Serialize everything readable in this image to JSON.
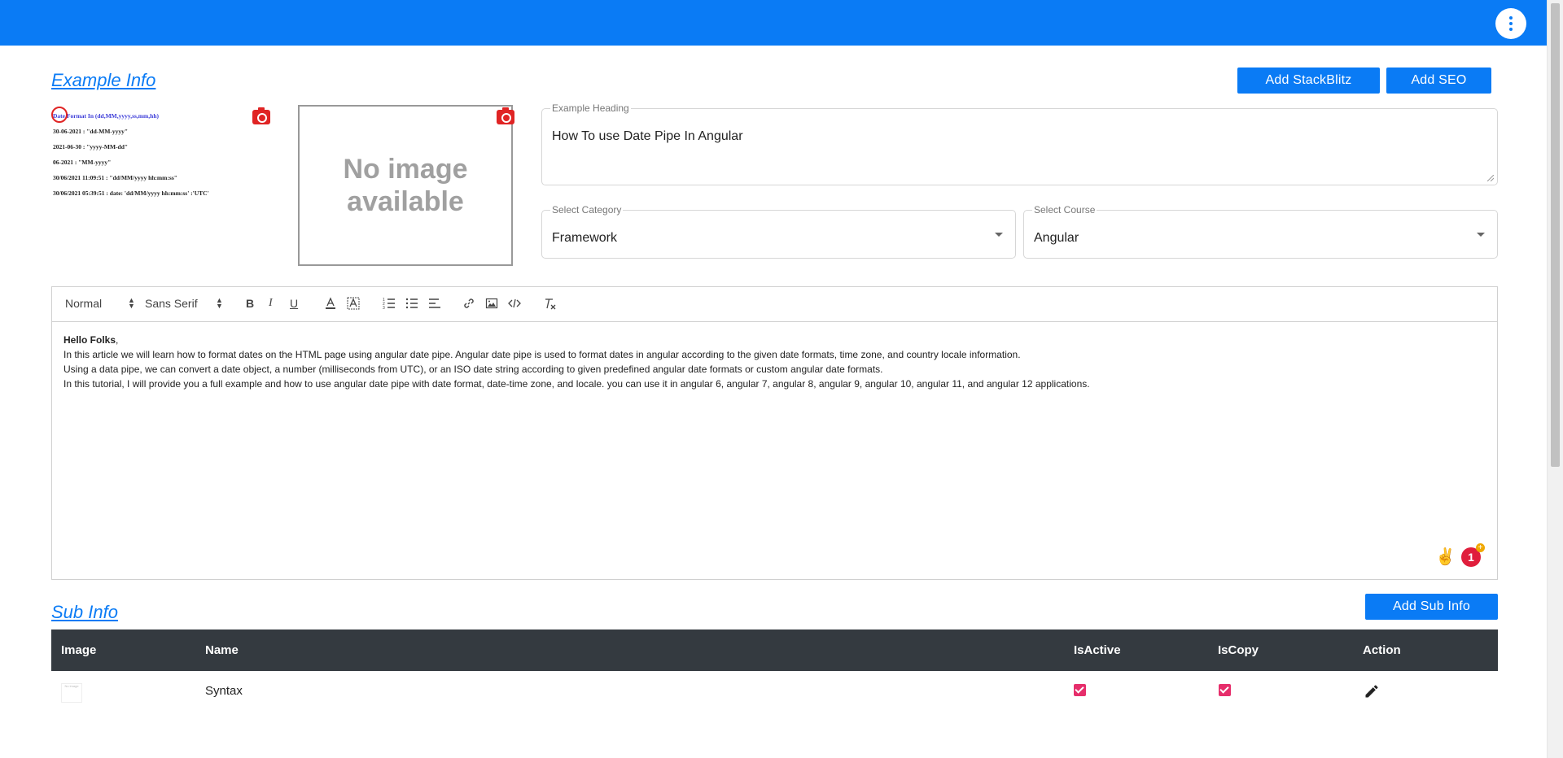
{
  "header": {
    "menu_icon": "more-vert-icon",
    "color": "#0a7bf5"
  },
  "example_info": {
    "title": "Example Info",
    "buttons": {
      "add_stackblitz": "Add StackBlitz",
      "add_seo": "Add SEO"
    },
    "thumbnail_lines": [
      "Date Format In (dd,MM,yyyy,ss,mm,hh)",
      "30-06-2021 : \"dd-MM-yyyy\"",
      "2021-06-30 : \"yyyy-MM-dd\"",
      "06-2021 : \"MM-yyyy\"",
      "30/06/2021 11:09:51 : \"dd/MM/yyyy hh:mm:ss\"",
      "30/06/2021 05:39:51 : date: 'dd/MM/yyyy hh:mm:ss' :'UTC'"
    ],
    "no_image_text": "No image available",
    "heading": {
      "label": "Example Heading",
      "value": "How To use Date Pipe In Angular"
    },
    "category": {
      "label": "Select Category",
      "value": "Framework"
    },
    "course": {
      "label": "Select Course",
      "value": "Angular"
    }
  },
  "editor": {
    "toolbar": {
      "header_select": "Normal",
      "font_select": "Sans Serif",
      "bold": "B",
      "italic": "I",
      "underline": "U"
    },
    "content": {
      "greeting_bold": "Hello Folks",
      "greeting_punct": ",",
      "paragraphs": [
        "In this article we will learn how to format dates on the HTML page using angular date pipe. Angular date pipe is used to format dates in angular according to the given date formats, time zone, and country locale information.",
        "Using a data pipe, we can convert a date object, a number (milliseconds from UTC), or an ISO date string according to given predefined angular date formats or custom angular date formats.",
        "In this tutorial, I will provide you a full example and how to use angular date pipe with date format, date-time zone, and locale. you can use it in angular 6, angular 7, angular 8, angular 9, angular 10, angular 11, and angular 12 applications."
      ]
    },
    "grammar_badge_count": "1",
    "emoji": "✌"
  },
  "sub_info": {
    "title": "Sub Info",
    "add_button": "Add Sub Info",
    "columns": [
      "Image",
      "Name",
      "IsActive",
      "IsCopy",
      "Action"
    ],
    "rows": [
      {
        "name": "Syntax",
        "is_active": true,
        "is_copy": true
      }
    ]
  },
  "colors": {
    "accent": "#0a7bf5",
    "table_header": "#343a40",
    "checkbox": "#e62e6b",
    "camera": "#e02424"
  }
}
